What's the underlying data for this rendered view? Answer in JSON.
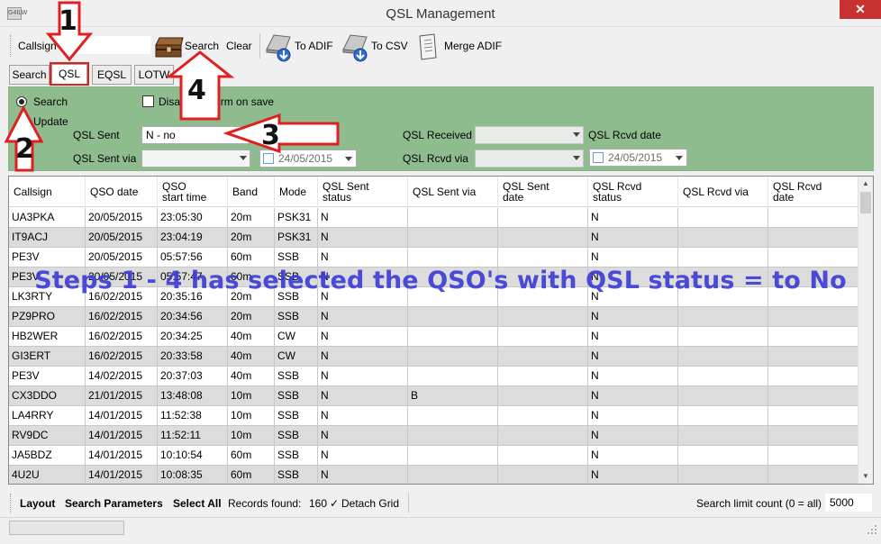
{
  "window": {
    "title": "QSL Management",
    "icon_text": "G4ILW",
    "close_label": "✕"
  },
  "toolbar": {
    "callsign_label": "Callsign",
    "callsign_value": "",
    "search_label": "Search",
    "clear_label": "Clear",
    "to_adif_label": "To ADIF",
    "to_csv_label": "To CSV",
    "merge_adif_label": "Merge ADIF"
  },
  "tabs": [
    {
      "label": "Search",
      "active": false
    },
    {
      "label": "QSL",
      "active": true
    },
    {
      "label": "EQSL",
      "active": false
    },
    {
      "label": "LOTW",
      "active": false
    }
  ],
  "filter": {
    "search_radio": "Search",
    "update_radio": "Update",
    "disable_checkbox_label": "Disable confirm on save",
    "qsl_sent_label": "QSL Sent",
    "qsl_sent_value": "N - no",
    "qsl_sent_via_label": "QSL Sent via",
    "qsl_sent_via_value": "",
    "qsl_sent_date_value": "24/05/2015",
    "qsl_received_label": "QSL Received",
    "qsl_received_value": "",
    "qsl_rcvd_date_label": "QSL Rcvd date",
    "qsl_rcvd_via_label": "QSL Rcvd via",
    "qsl_rcvd_via_value": "",
    "qsl_rcvd_date_value": "24/05/2015"
  },
  "grid": {
    "columns": [
      {
        "line1": "Callsign",
        "line2": ""
      },
      {
        "line1": "QSO date",
        "line2": ""
      },
      {
        "line1": "QSO",
        "line2": "start time"
      },
      {
        "line1": "Band",
        "line2": ""
      },
      {
        "line1": "Mode",
        "line2": ""
      },
      {
        "line1": "QSL Sent",
        "line2": "status"
      },
      {
        "line1": "QSL Sent via",
        "line2": ""
      },
      {
        "line1": "QSL Sent",
        "line2": "date"
      },
      {
        "line1": "QSL Rcvd",
        "line2": "status"
      },
      {
        "line1": "QSL Rcvd via",
        "line2": ""
      },
      {
        "line1": "QSL Rcvd",
        "line2": "date"
      }
    ],
    "rows": [
      [
        "UA3PKA",
        "20/05/2015",
        "23:05:30",
        "20m",
        "PSK31",
        "N",
        "",
        "",
        "N",
        "",
        ""
      ],
      [
        "IT9ACJ",
        "20/05/2015",
        "23:04:19",
        "20m",
        "PSK31",
        "N",
        "",
        "",
        "N",
        "",
        ""
      ],
      [
        "PE3V",
        "20/05/2015",
        "05:57:56",
        "60m",
        "SSB",
        "N",
        "",
        "",
        "N",
        "",
        ""
      ],
      [
        "PE3V",
        "20/05/2015",
        "05:57:47",
        "60m",
        "SSB",
        "N",
        "",
        "",
        "N",
        "",
        ""
      ],
      [
        "LK3RTY",
        "16/02/2015",
        "20:35:16",
        "20m",
        "SSB",
        "N",
        "",
        "",
        "N",
        "",
        ""
      ],
      [
        "PZ9PRO",
        "16/02/2015",
        "20:34:56",
        "20m",
        "SSB",
        "N",
        "",
        "",
        "N",
        "",
        ""
      ],
      [
        "HB2WER",
        "16/02/2015",
        "20:34:25",
        "40m",
        "CW",
        "N",
        "",
        "",
        "N",
        "",
        ""
      ],
      [
        "GI3ERT",
        "16/02/2015",
        "20:33:58",
        "40m",
        "CW",
        "N",
        "",
        "",
        "N",
        "",
        ""
      ],
      [
        "PE3V",
        "14/02/2015",
        "20:37:03",
        "40m",
        "SSB",
        "N",
        "",
        "",
        "N",
        "",
        ""
      ],
      [
        "CX3DDO",
        "21/01/2015",
        "13:48:08",
        "10m",
        "SSB",
        "N",
        "B",
        "",
        "N",
        "",
        ""
      ],
      [
        "LA4RRY",
        "14/01/2015",
        "11:52:38",
        "10m",
        "SSB",
        "N",
        "",
        "",
        "N",
        "",
        ""
      ],
      [
        "RV9DC",
        "14/01/2015",
        "11:52:11",
        "10m",
        "SSB",
        "N",
        "",
        "",
        "N",
        "",
        ""
      ],
      [
        "JA5BDZ",
        "14/01/2015",
        "10:10:54",
        "60m",
        "SSB",
        "N",
        "",
        "",
        "N",
        "",
        ""
      ],
      [
        "4U2U",
        "14/01/2015",
        "10:08:35",
        "60m",
        "SSB",
        "N",
        "",
        "",
        "N",
        "",
        ""
      ]
    ]
  },
  "annotation": {
    "overlay_text": "Steps 1 - 4 has selected the QSO's with QSL status = to No",
    "steps": [
      "1",
      "2",
      "3",
      "4"
    ],
    "color": "#e02020"
  },
  "bottombar": {
    "layout_label": "Layout",
    "search_params_label": "Search Parameters",
    "select_all_label": "Select All",
    "records_found_label": "Records found:",
    "records_found_value": "160",
    "detach_grid_label": "Detach Grid",
    "search_limit_label": "Search limit count (0 = all)",
    "search_limit_value": "5000"
  },
  "status": {
    "progress_fraction": 0
  }
}
